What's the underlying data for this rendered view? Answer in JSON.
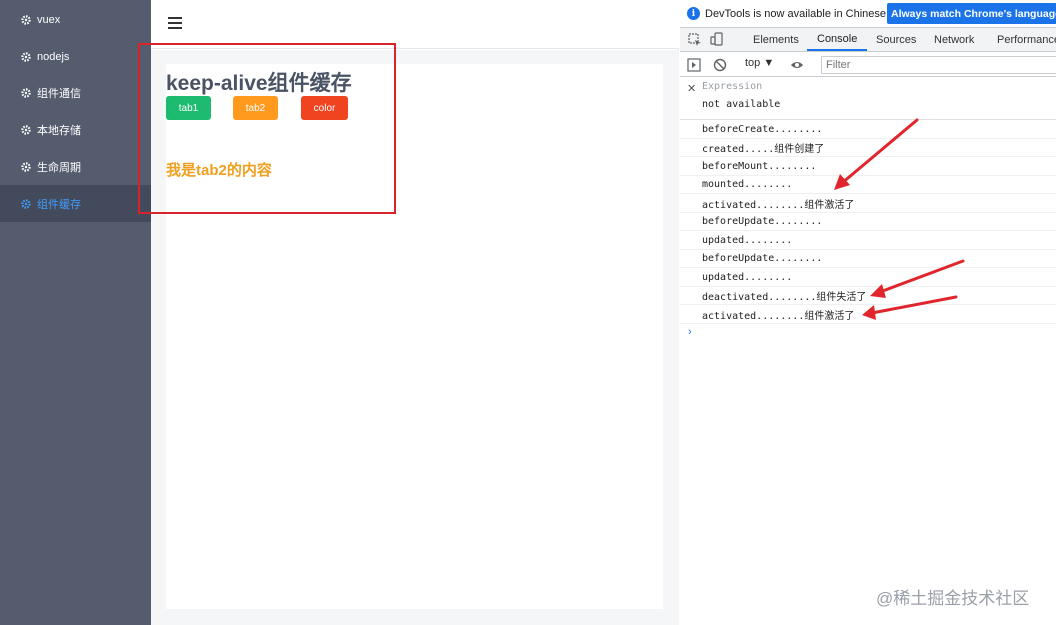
{
  "sidebar": {
    "items": [
      {
        "label": "vuex",
        "active": false
      },
      {
        "label": "nodejs",
        "active": false
      },
      {
        "label": "组件通信",
        "active": false
      },
      {
        "label": "本地存储",
        "active": false
      },
      {
        "label": "生命周期",
        "active": false
      },
      {
        "label": "组件缓存",
        "active": true
      }
    ],
    "icon": "gear-icon"
  },
  "main": {
    "title": "keep-alive组件缓存",
    "buttons": {
      "tab1": "tab1",
      "tab2": "tab2",
      "color": "color"
    },
    "tab_content": "我是tab2的内容"
  },
  "devtools": {
    "infobar": {
      "text": "DevTools is now available in Chinese!",
      "button": "Always match Chrome's language"
    },
    "tabs": [
      "Elements",
      "Console",
      "Sources",
      "Network",
      "Performance"
    ],
    "active_tab": "Console",
    "toolbar": {
      "context": "top",
      "filter_placeholder": "Filter"
    },
    "expression": {
      "label": "Expression",
      "value": "not available"
    },
    "logs": [
      "beforeCreate........",
      "created.....组件创建了",
      "beforeMount........",
      "mounted........",
      "activated........组件激活了",
      "beforeUpdate........",
      "updated........",
      "beforeUpdate........",
      "updated........",
      "deactivated........组件失活了",
      "activated........组件激活了"
    ],
    "prompt": "›"
  },
  "watermark": "@稀土掘金技术社区",
  "colors": {
    "sidebar_bg": "#545c6e",
    "sidebar_active_text": "#409eff",
    "tab1": "#1dbb70",
    "tab2": "#ff9a1f",
    "color": "#f0431f",
    "highlight": "#d8232a",
    "devtools_accent": "#1a73e8"
  }
}
